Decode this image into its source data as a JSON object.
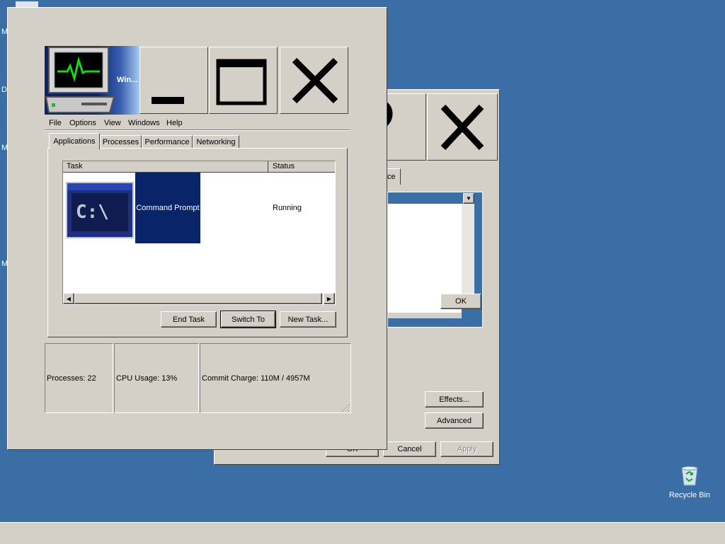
{
  "desktop": {
    "edge_letters": [
      "M",
      "D",
      "M",
      "M"
    ],
    "recycle_bin_label": "Recycle Bin"
  },
  "display_properties": {
    "tab_fragment": "ce",
    "inner_ok_label": "OK",
    "effects_label": "Effects...",
    "advanced_label": "Advanced",
    "ok_label": "OK",
    "cancel_label": "Cancel",
    "apply_label": "Apply"
  },
  "task_manager": {
    "title_short": "Win...",
    "menu": [
      "File",
      "Options",
      "View",
      "Windows",
      "Help"
    ],
    "tabs": [
      "Applications",
      "Processes",
      "Performance",
      "Networking"
    ],
    "columns": [
      "Task",
      "Status"
    ],
    "tasks": [
      {
        "name": "Command Prompt",
        "status": "Running",
        "icon": "command-prompt-icon"
      }
    ],
    "buttons": {
      "end_task": "End Task",
      "switch_to": "Switch To",
      "new_task": "New Task..."
    },
    "status": {
      "processes": "Processes: 22",
      "cpu": "CPU Usage: 13%",
      "commit": "Commit Charge: 110M / 4957M"
    }
  },
  "colors": {
    "desktop": "#3a6ea5",
    "face": "#d4d0c8",
    "selection": "#0a246a"
  }
}
